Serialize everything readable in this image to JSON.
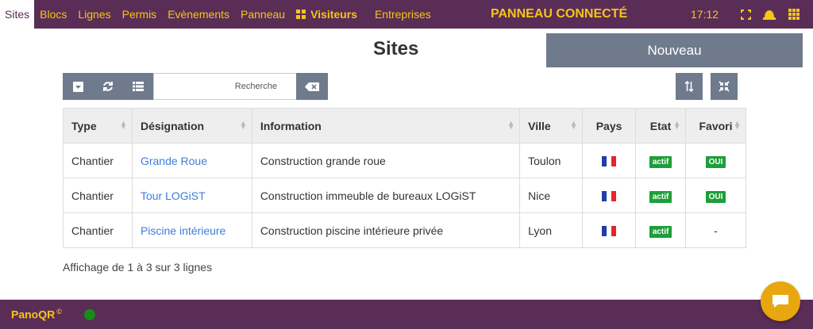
{
  "nav": {
    "items": [
      {
        "label": "Sites"
      },
      {
        "label": "Blocs"
      },
      {
        "label": "Lignes"
      },
      {
        "label": "Permis"
      },
      {
        "label": "Evènements"
      },
      {
        "label": "Panneau"
      },
      {
        "label": "Visiteurs"
      },
      {
        "label": "Entreprises"
      }
    ],
    "active": "Sites",
    "title": "PANNEAU CONNECTÉ",
    "clock": "17:12"
  },
  "colors": {
    "topbar": "#5a2d57",
    "accent": "#f5c518",
    "button": "#6f7b8c",
    "badge": "#1e9e3a",
    "link": "#3d7dd8",
    "chat": "#e8a60f"
  },
  "page": {
    "title": "Sites",
    "new_button": "Nouveau"
  },
  "search": {
    "placeholder": "Recherche"
  },
  "table": {
    "columns": [
      "Type",
      "Désignation",
      "Information",
      "Ville",
      "Pays",
      "Etat",
      "Favori"
    ],
    "rows": [
      {
        "type": "Chantier",
        "designation": "Grande Roue",
        "information": "Construction grande roue",
        "ville": "Toulon",
        "pays": "france-flag",
        "etat": "actif",
        "favori": "OUI"
      },
      {
        "type": "Chantier",
        "designation": "Tour LOGiST",
        "information": "Construction immeuble de bureaux LOGiST",
        "ville": "Nice",
        "pays": "france-flag",
        "etat": "actif",
        "favori": "OUI"
      },
      {
        "type": "Chantier",
        "designation": "Piscine intérieure",
        "information": "Construction piscine intérieure privée",
        "ville": "Lyon",
        "pays": "france-flag",
        "etat": "actif",
        "favori": "-"
      }
    ]
  },
  "footer_text": "Affichage de 1 à 3 sur 3 lignes",
  "bottombar": {
    "brand": "PanoQR",
    "brand_mark": "©"
  }
}
